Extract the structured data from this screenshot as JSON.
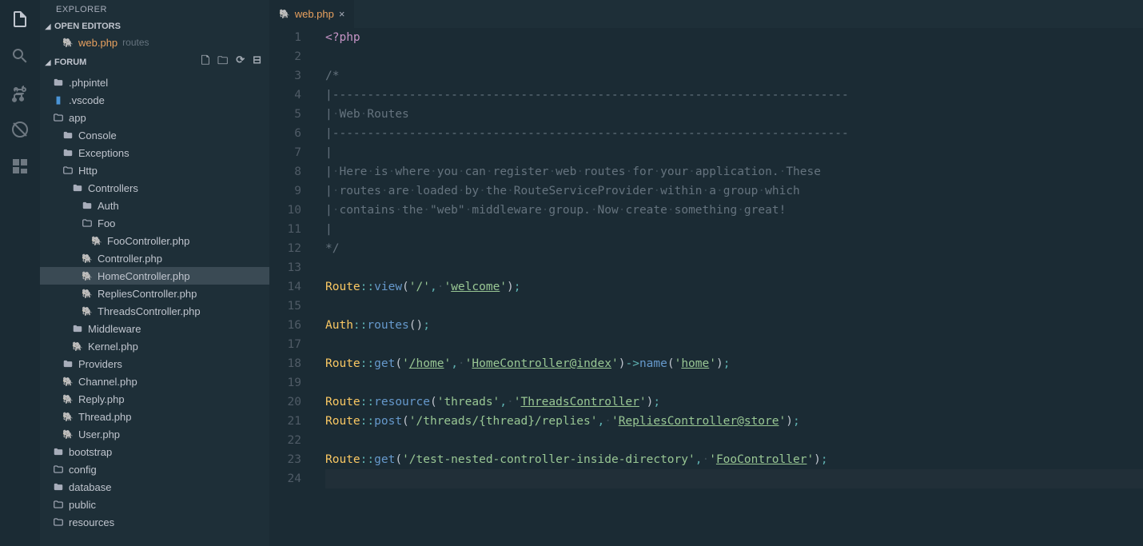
{
  "activityBar": {
    "items": [
      "explorer",
      "search",
      "scm",
      "debug",
      "extensions"
    ]
  },
  "sidebar": {
    "title": "EXPLORER",
    "sections": {
      "openEditors": {
        "label": "OPEN EDITORS",
        "items": [
          {
            "name": "web.php",
            "hint": "routes"
          }
        ]
      },
      "project": {
        "label": "FORUM",
        "tree": [
          {
            "t": "folder",
            "depth": 0,
            "name": ".phpintel",
            "open": false
          },
          {
            "t": "folder",
            "depth": 0,
            "name": ".vscode",
            "open": false,
            "iconColor": "vs"
          },
          {
            "t": "folder",
            "depth": 0,
            "name": "app",
            "open": true
          },
          {
            "t": "folder",
            "depth": 1,
            "name": "Console",
            "open": false
          },
          {
            "t": "folder",
            "depth": 1,
            "name": "Exceptions",
            "open": false
          },
          {
            "t": "folder",
            "depth": 1,
            "name": "Http",
            "open": true
          },
          {
            "t": "folder",
            "depth": 2,
            "name": "Controllers",
            "open": true,
            "closedIcon": true
          },
          {
            "t": "folder",
            "depth": 3,
            "name": "Auth",
            "open": false
          },
          {
            "t": "folder",
            "depth": 3,
            "name": "Foo",
            "open": true
          },
          {
            "t": "file",
            "depth": 4,
            "name": "FooController.php",
            "ext": "php"
          },
          {
            "t": "file",
            "depth": 3,
            "name": "Controller.php",
            "ext": "php"
          },
          {
            "t": "file",
            "depth": 3,
            "name": "HomeController.php",
            "ext": "php",
            "selected": true
          },
          {
            "t": "file",
            "depth": 3,
            "name": "RepliesController.php",
            "ext": "php"
          },
          {
            "t": "file",
            "depth": 3,
            "name": "ThreadsController.php",
            "ext": "php"
          },
          {
            "t": "folder",
            "depth": 2,
            "name": "Middleware",
            "open": false
          },
          {
            "t": "file",
            "depth": 2,
            "name": "Kernel.php",
            "ext": "php"
          },
          {
            "t": "folder",
            "depth": 1,
            "name": "Providers",
            "open": false
          },
          {
            "t": "file",
            "depth": 1,
            "name": "Channel.php",
            "ext": "php"
          },
          {
            "t": "file",
            "depth": 1,
            "name": "Reply.php",
            "ext": "php"
          },
          {
            "t": "file",
            "depth": 1,
            "name": "Thread.php",
            "ext": "php"
          },
          {
            "t": "file",
            "depth": 1,
            "name": "User.php",
            "ext": "php"
          },
          {
            "t": "folder",
            "depth": 0,
            "name": "bootstrap",
            "open": false
          },
          {
            "t": "folder",
            "depth": 0,
            "name": "config",
            "open": true,
            "closedIcon": false
          },
          {
            "t": "folder",
            "depth": 0,
            "name": "database",
            "open": false
          },
          {
            "t": "folder",
            "depth": 0,
            "name": "public",
            "open": true,
            "closedIcon": false
          },
          {
            "t": "folder",
            "depth": 0,
            "name": "resources",
            "open": true,
            "closedIcon": false
          }
        ]
      }
    }
  },
  "editor": {
    "tab": {
      "name": "web.php"
    },
    "lineCount": 24,
    "currentLine": 24,
    "code": {
      "l1": "<?php",
      "l3": "/*",
      "l4": "|--------------------------------------------------------------------------",
      "l5": "| Web Routes",
      "l6": "|--------------------------------------------------------------------------",
      "l7": "|",
      "l8": "| Here is where you can register web routes for your application. These",
      "l9": "| routes are loaded by the RouteServiceProvider within a group which",
      "l10": "| contains the \"web\" middleware group. Now create something great!",
      "l11": "|",
      "l12": "*/",
      "route": "Route",
      "auth": "Auth",
      "view": "view",
      "routes_fn": "routes",
      "get": "get",
      "post": "post",
      "resource": "resource",
      "name": "name",
      "s_slash": "/",
      "s_welcome": "welcome",
      "s_home": "/home",
      "s_homectrl": "HomeController@index",
      "s_homename": "home",
      "s_threads": "threads",
      "s_threadsctrl": "ThreadsController",
      "s_threadsreplies": "/threads/{thread}/replies",
      "s_repliesctrl": "RepliesController@store",
      "s_testroute": "/test-nested-controller-inside-directory",
      "s_fooctrl": "FooController"
    }
  }
}
